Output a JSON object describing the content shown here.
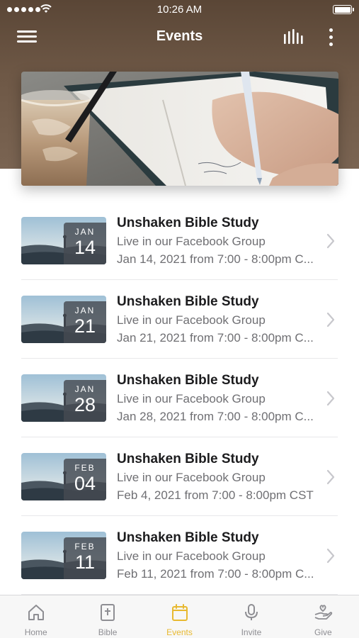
{
  "status_bar": {
    "time": "10:26 AM"
  },
  "header": {
    "title": "Events",
    "background_color": "#6b5544"
  },
  "events": [
    {
      "month": "JAN",
      "day": "14",
      "title": "Unshaken Bible Study",
      "location": "Live in our Facebook Group",
      "time": "Jan 14, 2021 from 7:00 - 8:00pm C..."
    },
    {
      "month": "JAN",
      "day": "21",
      "title": "Unshaken Bible Study",
      "location": "Live in our Facebook Group",
      "time": "Jan 21, 2021 from 7:00 - 8:00pm C..."
    },
    {
      "month": "JAN",
      "day": "28",
      "title": "Unshaken Bible Study",
      "location": "Live in our Facebook Group",
      "time": "Jan 28, 2021 from 7:00 - 8:00pm C..."
    },
    {
      "month": "FEB",
      "day": "04",
      "title": "Unshaken Bible Study",
      "location": "Live in our Facebook Group",
      "time": "Feb 4, 2021 from 7:00 - 8:00pm CST"
    },
    {
      "month": "FEB",
      "day": "11",
      "title": "Unshaken Bible Study",
      "location": "Live in our Facebook Group",
      "time": "Feb 11, 2021 from 7:00 - 8:00pm C..."
    }
  ],
  "tab_bar": {
    "tabs": [
      {
        "label": "Home",
        "icon": "home-icon",
        "active": false
      },
      {
        "label": "Bible",
        "icon": "bible-icon",
        "active": false
      },
      {
        "label": "Events",
        "icon": "calendar-icon",
        "active": true
      },
      {
        "label": "Invite",
        "icon": "microphone-icon",
        "active": false
      },
      {
        "label": "Give",
        "icon": "give-hand-heart-icon",
        "active": false
      }
    ],
    "active_color": "#e8b931",
    "inactive_color": "#8e8e93"
  }
}
